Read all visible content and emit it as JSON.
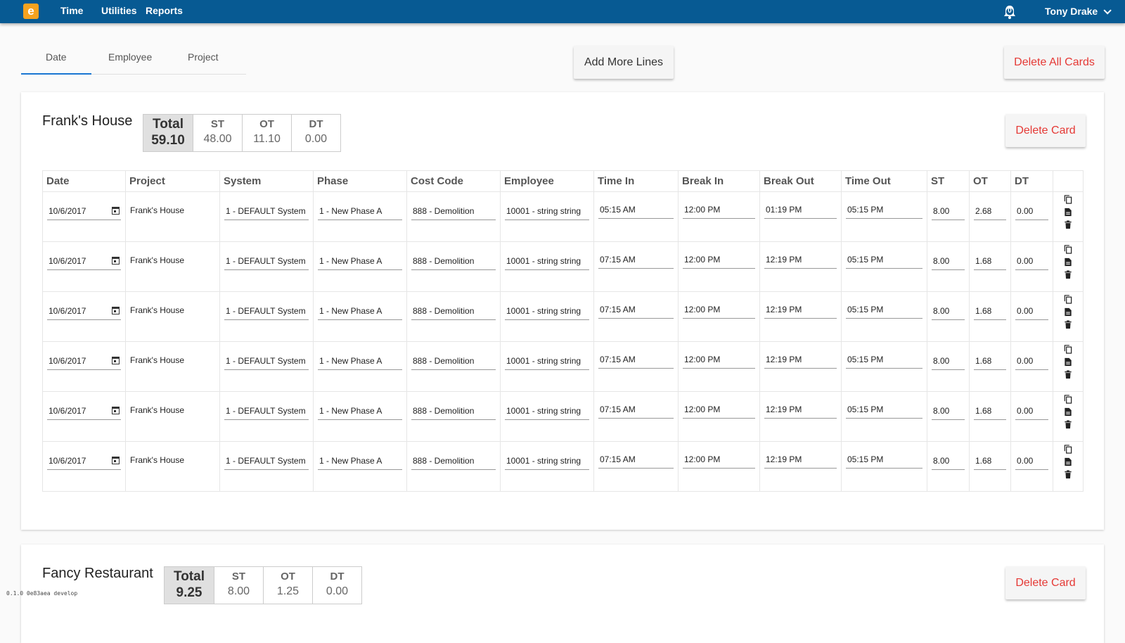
{
  "nav": {
    "logo": "e",
    "items": [
      "Time",
      "Utilities",
      "Reports"
    ],
    "notification_count": "0",
    "user": "Tony Drake"
  },
  "tabs": [
    "Date",
    "Employee",
    "Project"
  ],
  "buttons": {
    "add_more_lines": "Add More Lines",
    "delete_all_cards": "Delete All Cards",
    "delete_card": "Delete Card"
  },
  "columns": [
    "Date",
    "Project",
    "System",
    "Phase",
    "Cost Code",
    "Employee",
    "Time In",
    "Break In",
    "Break Out",
    "Time Out",
    "ST",
    "OT",
    "DT"
  ],
  "cards": [
    {
      "title": "Frank's House",
      "totals": {
        "total_label": "Total",
        "total": "59.10",
        "st_label": "ST",
        "st": "48.00",
        "ot_label": "OT",
        "ot": "11.10",
        "dt_label": "DT",
        "dt": "0.00"
      },
      "rows": [
        {
          "date": "10/6/2017",
          "project": "Frank's House",
          "system": "1 - DEFAULT System",
          "phase": "1 - New Phase A",
          "cost_code": "888 - Demolition",
          "employee": "10001 - string string",
          "time_in": "05:15 AM",
          "break_in": "12:00 PM",
          "break_out": "01:19 PM",
          "time_out": "05:15 PM",
          "st": "8.00",
          "ot": "2.68",
          "dt": "0.00"
        },
        {
          "date": "10/6/2017",
          "project": "Frank's House",
          "system": "1 - DEFAULT System",
          "phase": "1 - New Phase A",
          "cost_code": "888 - Demolition",
          "employee": "10001 - string string",
          "time_in": "07:15 AM",
          "break_in": "12:00 PM",
          "break_out": "12:19 PM",
          "time_out": "05:15 PM",
          "st": "8.00",
          "ot": "1.68",
          "dt": "0.00"
        },
        {
          "date": "10/6/2017",
          "project": "Frank's House",
          "system": "1 - DEFAULT System",
          "phase": "1 - New Phase A",
          "cost_code": "888 - Demolition",
          "employee": "10001 - string string",
          "time_in": "07:15 AM",
          "break_in": "12:00 PM",
          "break_out": "12:19 PM",
          "time_out": "05:15 PM",
          "st": "8.00",
          "ot": "1.68",
          "dt": "0.00"
        },
        {
          "date": "10/6/2017",
          "project": "Frank's House",
          "system": "1 - DEFAULT System",
          "phase": "1 - New Phase A",
          "cost_code": "888 - Demolition",
          "employee": "10001 - string string",
          "time_in": "07:15 AM",
          "break_in": "12:00 PM",
          "break_out": "12:19 PM",
          "time_out": "05:15 PM",
          "st": "8.00",
          "ot": "1.68",
          "dt": "0.00"
        },
        {
          "date": "10/6/2017",
          "project": "Frank's House",
          "system": "1 - DEFAULT System",
          "phase": "1 - New Phase A",
          "cost_code": "888 - Demolition",
          "employee": "10001 - string string",
          "time_in": "07:15 AM",
          "break_in": "12:00 PM",
          "break_out": "12:19 PM",
          "time_out": "05:15 PM",
          "st": "8.00",
          "ot": "1.68",
          "dt": "0.00"
        },
        {
          "date": "10/6/2017",
          "project": "Frank's House",
          "system": "1 - DEFAULT System",
          "phase": "1 - New Phase A",
          "cost_code": "888 - Demolition",
          "employee": "10001 - string string",
          "time_in": "07:15 AM",
          "break_in": "12:00 PM",
          "break_out": "12:19 PM",
          "time_out": "05:15 PM",
          "st": "8.00",
          "ot": "1.68",
          "dt": "0.00"
        }
      ]
    },
    {
      "title": "Fancy Restaurant",
      "totals": {
        "total_label": "Total",
        "total": "9.25",
        "st_label": "ST",
        "st": "8.00",
        "ot_label": "OT",
        "ot": "1.25",
        "dt_label": "DT",
        "dt": "0.00"
      }
    }
  ],
  "version": "0.1.0 0e83aea develop",
  "colors": {
    "nav": "#075a93",
    "accent": "#1976d2",
    "danger": "#e53935"
  },
  "icons": [
    "bell-icon",
    "chevron-down-icon",
    "calendar-icon",
    "copy-icon",
    "document-icon",
    "trash-icon"
  ]
}
